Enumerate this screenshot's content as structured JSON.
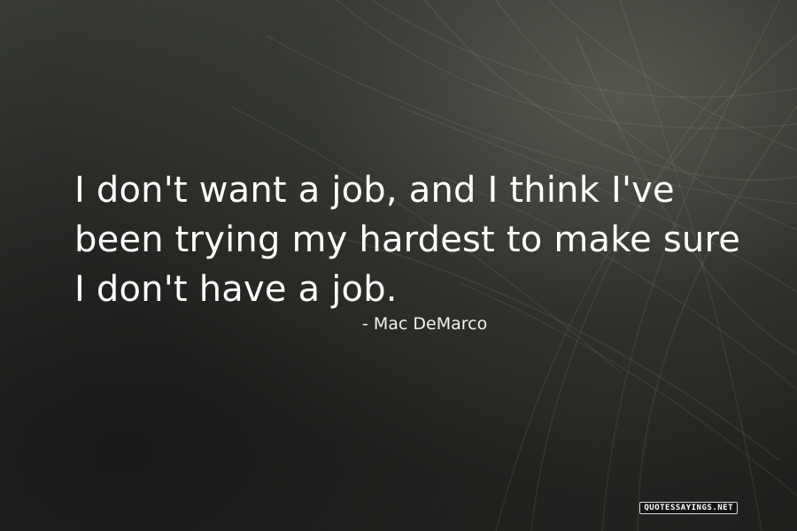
{
  "quote": {
    "text": "I don't want a job, and I think I've been trying my hardest to make sure I don't have a job.",
    "author": "- Mac DeMarco"
  },
  "watermark": {
    "text": "QUOTESSAYINGS.NET"
  },
  "colors": {
    "background_dark": "#262824",
    "background_light": "#787c6e",
    "text": "#ffffff"
  }
}
